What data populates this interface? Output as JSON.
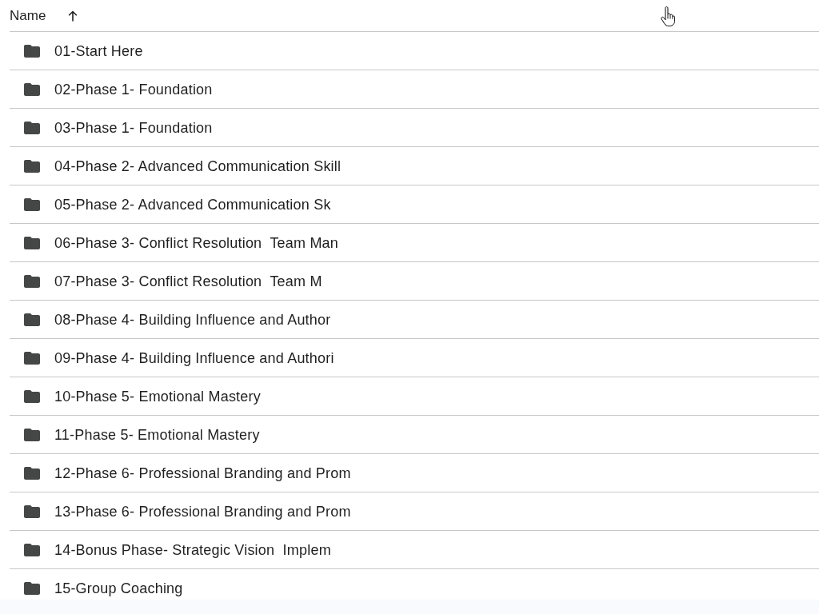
{
  "header": {
    "column": "Name",
    "sort_ascending": true
  },
  "rows": [
    {
      "name": "01-Start Here"
    },
    {
      "name": "02-Phase 1- Foundation"
    },
    {
      "name": "03-Phase 1- Foundation"
    },
    {
      "name": "04-Phase 2- Advanced Communication Skill"
    },
    {
      "name": "05-Phase 2- Advanced Communication Sk"
    },
    {
      "name": "06-Phase 3- Conflict Resolution  Team Man"
    },
    {
      "name": "07-Phase 3- Conflict Resolution  Team M"
    },
    {
      "name": "08-Phase 4- Building Influence and Author"
    },
    {
      "name": "09-Phase 4- Building Influence and Authori"
    },
    {
      "name": "10-Phase 5- Emotional Mastery"
    },
    {
      "name": "11-Phase 5- Emotional Mastery"
    },
    {
      "name": "12-Phase 6- Professional Branding and Prom"
    },
    {
      "name": "13-Phase 6- Professional Branding and Prom"
    },
    {
      "name": "14-Bonus Phase- Strategic Vision  Implem"
    },
    {
      "name": "15-Group Coaching"
    }
  ]
}
